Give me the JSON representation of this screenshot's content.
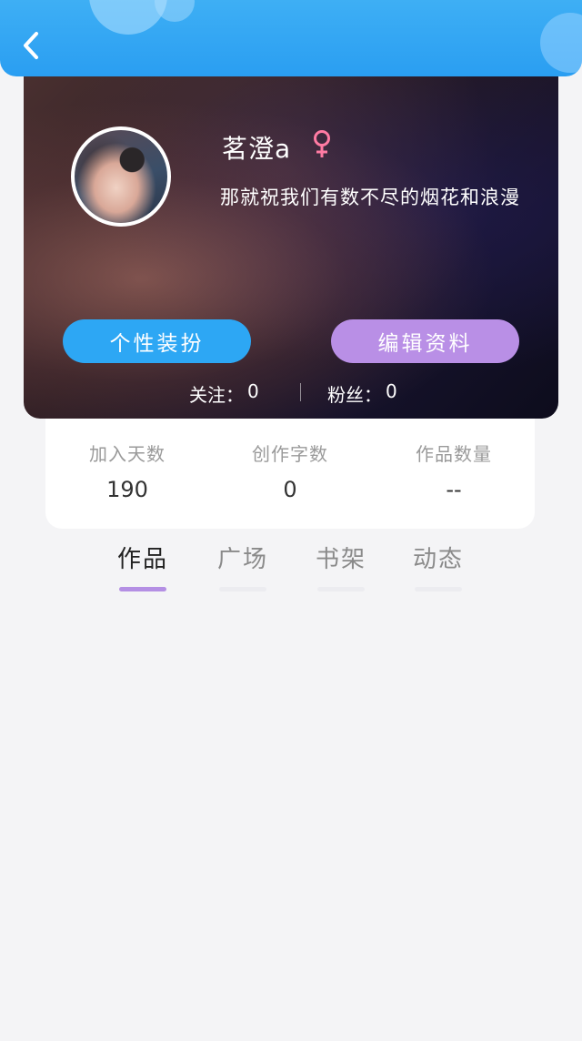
{
  "header": {
    "back_icon": "chevron-left-icon",
    "accent_color": "#2a9ef2"
  },
  "profile": {
    "username": "茗澄a",
    "gender_icon": "female-icon",
    "gender_color": "#ff7ba3",
    "bio": "那就祝我们有数不尽的烟花和浪漫",
    "buttons": {
      "dress_label": "个性装扮",
      "edit_label": "编辑资料"
    },
    "following": {
      "label": "关注：",
      "count": "0"
    },
    "fans": {
      "label": "粉丝：",
      "count": "0"
    }
  },
  "stats": [
    {
      "label": "加入天数",
      "value": "190"
    },
    {
      "label": "创作字数",
      "value": "0"
    },
    {
      "label": "作品数量",
      "value": "--"
    }
  ],
  "tabs": [
    {
      "label": "作品",
      "active": true
    },
    {
      "label": "广场",
      "active": false
    },
    {
      "label": "书架",
      "active": false
    },
    {
      "label": "动态",
      "active": false
    }
  ],
  "colors": {
    "dress_button": "#2da7f4",
    "edit_button": "#b98fe6",
    "tab_indicator": "#b48fe4"
  }
}
